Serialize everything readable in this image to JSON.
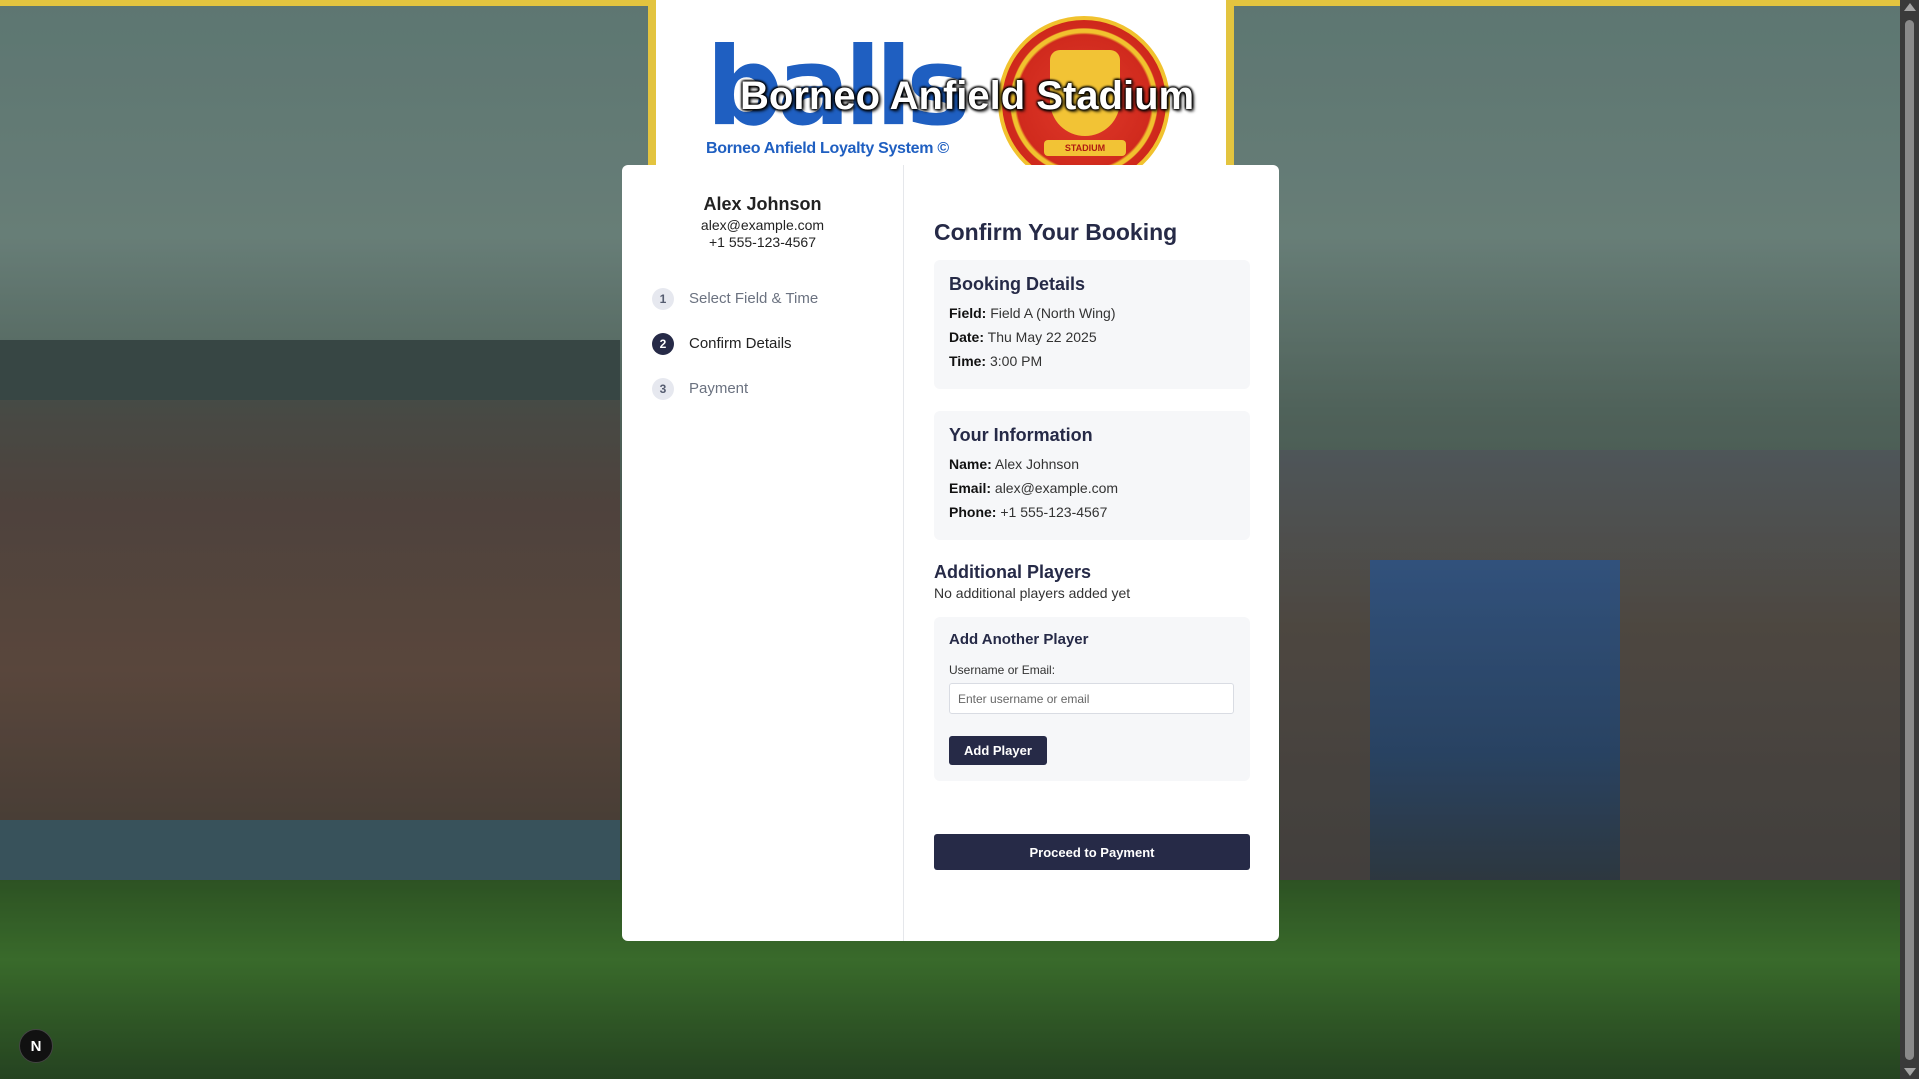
{
  "header": {
    "logo_word": "balls",
    "logo_subtitle": "Borneo Anfield Loyalty System ©",
    "stadium_title": "Borneo Anfield Stadium",
    "crest_band": "STADIUM"
  },
  "user": {
    "name": "Alex Johnson",
    "email": "alex@example.com",
    "phone": "+1 555-123-4567"
  },
  "steps": [
    {
      "num": "1",
      "label": "Select Field & Time",
      "active": false
    },
    {
      "num": "2",
      "label": "Confirm Details",
      "active": true
    },
    {
      "num": "3",
      "label": "Payment",
      "active": false
    }
  ],
  "main": {
    "title": "Confirm Your Booking",
    "booking": {
      "heading": "Booking Details",
      "field_label": "Field:",
      "field_value": "Field A (North Wing)",
      "date_label": "Date:",
      "date_value": "Thu May 22 2025",
      "time_label": "Time:",
      "time_value": "3:00 PM"
    },
    "info": {
      "heading": "Your Information",
      "name_label": "Name:",
      "name_value": "Alex Johnson",
      "email_label": "Email:",
      "email_value": "alex@example.com",
      "phone_label": "Phone:",
      "phone_value": "+1 555-123-4567"
    },
    "additional": {
      "heading": "Additional Players",
      "empty_text": "No additional players added yet"
    },
    "add_player": {
      "heading": "Add Another Player",
      "field_label": "Username or Email:",
      "placeholder": "Enter username or email",
      "value": "",
      "button": "Add Player"
    },
    "proceed_button": "Proceed to Payment"
  },
  "dev_badge": "N",
  "colors": {
    "accent": "#262a47",
    "frame": "#e3c43f",
    "logo_blue": "#1f5fc1",
    "crest_red": "#d02a1d"
  }
}
